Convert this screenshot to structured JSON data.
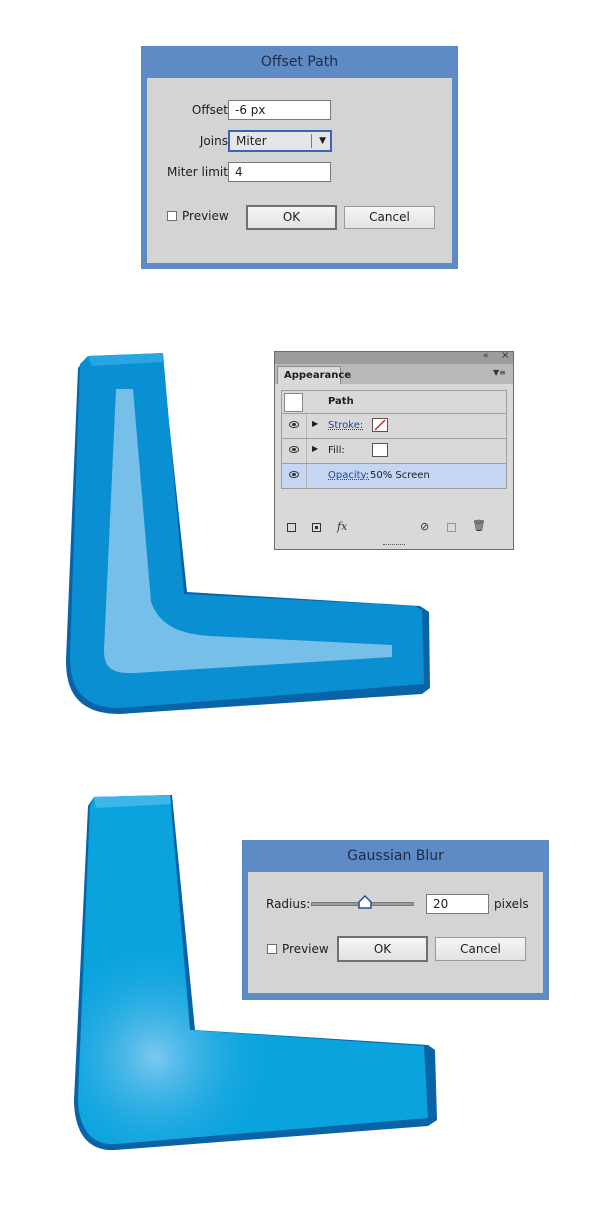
{
  "offset_path": {
    "title": "Offset Path",
    "offset_label": "Offset:",
    "offset_value": "-6 px",
    "joins_label": "Joins:",
    "joins_value": "Miter",
    "miter_label": "Miter limit:",
    "miter_value": "4",
    "preview_label": "Preview",
    "ok_label": "OK",
    "cancel_label": "Cancel"
  },
  "appearance": {
    "tab_label": "Appearance",
    "path_label": "Path",
    "stroke_label": "Stroke:",
    "fill_label": "Fill:",
    "opacity_label": "Opacity:",
    "opacity_value": "50% Screen",
    "fx_label": "fx"
  },
  "gaussian_blur": {
    "title": "Gaussian Blur",
    "radius_label": "Radius:",
    "radius_value": "20",
    "units_label": "pixels",
    "preview_label": "Preview",
    "ok_label": "OK",
    "cancel_label": "Cancel"
  },
  "colors": {
    "dialog_frame": "#5e8ac6",
    "dialog_body": "#d4d4d4",
    "shape_outer": "#0d8fd4",
    "shape_inner_highlight": "#76bfe8",
    "shape_edge": "#0a63a6"
  }
}
